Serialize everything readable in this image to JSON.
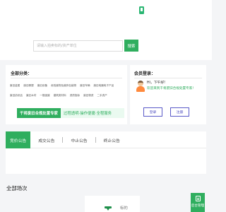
{
  "colors": {
    "accent": "#2fae5e",
    "login_border": "#5a5ac8",
    "page_bg": "#f4f5f7"
  },
  "header": {
    "phone_icon": "phone-icon"
  },
  "search": {
    "placeholder": "请输入拍卖标的/资产单位",
    "button_label": "搜索"
  },
  "categories": {
    "title": "全部分类：",
    "items": [
      "废旧金属",
      "废旧橡塑",
      "废旧设备",
      "危险废物及废弃包装物",
      "废旧车辆",
      "废旧电器电子产品",
      "废旧纺织品",
      "废旧木材",
      "一般固废",
      "建筑类材料",
      "资质指标",
      "废旧物资",
      "二手资产"
    ]
  },
  "banner": {
    "main_text": "干将废旧合规处置专家",
    "sub_text": "过程透明·操作便捷·全程服务"
  },
  "member": {
    "title": "会员登录：",
    "avatar_icon": "user-avatar-icon",
    "greeting": "Hi，下午好!",
    "welcome": "欢迎来到干将废旧合规处置专家!",
    "login_label": "登录",
    "register_label": "注册"
  },
  "tabs": [
    {
      "label": "竞价公告",
      "active": true
    },
    {
      "label": "成交公告",
      "active": false
    },
    {
      "label": "中止公告",
      "active": false
    },
    {
      "label": "终止公告",
      "active": false
    }
  ],
  "all_venues": {
    "title": "全部场次"
  },
  "thumb": {
    "text": "标的"
  },
  "float_button": {
    "label": "后台管理",
    "icon": "clipboard-icon"
  }
}
